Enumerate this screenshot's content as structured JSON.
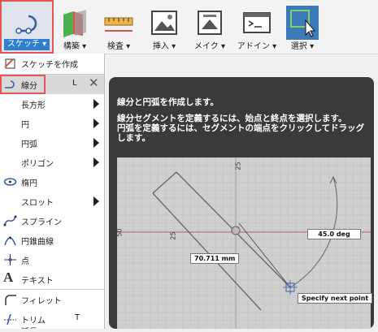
{
  "toolbar": {
    "sketch": "スケッチ ▾",
    "construct": "構築 ▾",
    "inspect": "検査 ▾",
    "insert": "挿入 ▾",
    "make": "メイク ▾",
    "addins": "アドイン ▾",
    "select": "選択 ▾"
  },
  "menu": {
    "create_sketch": "スケッチを作成",
    "line": "線分",
    "line_shortcut": "L",
    "rectangle": "長方形",
    "circle": "円",
    "arc": "円弧",
    "polygon": "ポリゴン",
    "ellipse": "楕円",
    "slot": "スロット",
    "spline": "スプライン",
    "conic": "円錐曲線",
    "point": "点",
    "text": "テキスト",
    "fillet": "フィレット",
    "trim": "トリム",
    "trim_shortcut": "T",
    "extend": "延長"
  },
  "tooltip": {
    "title": "線分と円弧を作成します。",
    "description": "線分セグメントを定義するには、始点と終点を選択します。\n円弧を定義するには、セグメントの端点をクリックしてドラッグします。"
  },
  "preview": {
    "dim_length": "70.711 mm",
    "dim_angle": "45.0 deg",
    "prompt": "Specify next point",
    "axis_label_top": "25",
    "axis_label_mid": "25",
    "axis_label_left": "50"
  }
}
